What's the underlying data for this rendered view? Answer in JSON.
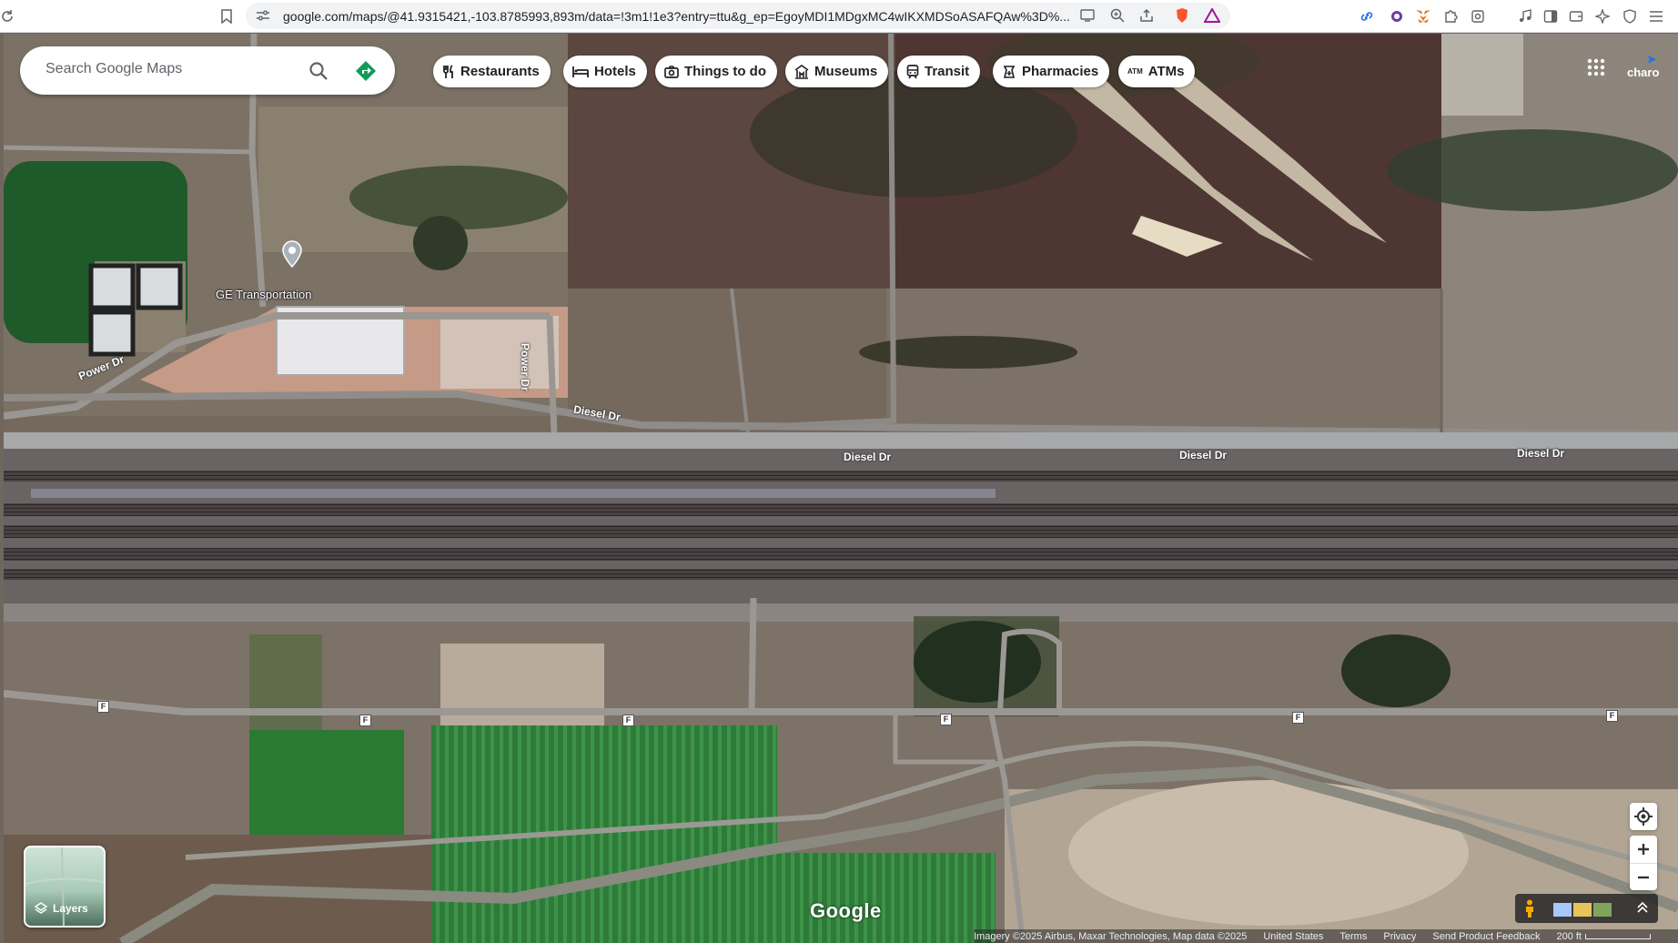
{
  "browser": {
    "url": "google.com/maps/@41.9315421,-103.8785993,893m/data=!3m1!1e3?entry=ttu&g_ep=EgoyMDI1MDgxMC4wIKXMDSoASAFQAw%3D%..."
  },
  "search": {
    "placeholder": "Search Google Maps"
  },
  "chips": [
    {
      "label": "Restaurants",
      "icon": "fork-knife-icon"
    },
    {
      "label": "Hotels",
      "icon": "bed-icon"
    },
    {
      "label": "Things to do",
      "icon": "camera-icon"
    },
    {
      "label": "Museums",
      "icon": "museum-icon"
    },
    {
      "label": "Transit",
      "icon": "train-icon"
    },
    {
      "label": "Pharmacies",
      "icon": "pharmacy-icon"
    },
    {
      "label": "ATMs",
      "icon": "atm-icon"
    }
  ],
  "atm_glyph": "ATM",
  "account_label": "charo",
  "map": {
    "place_name": "GE Transportation",
    "roads": {
      "power_dr_1": "Power Dr",
      "power_dr_2": "Power Dr",
      "diesel_dr_1": "Diesel Dr",
      "diesel_dr_2": "Diesel Dr",
      "diesel_dr_3": "Diesel Dr",
      "diesel_dr_4": "Diesel Dr"
    },
    "route_marker": "F"
  },
  "layers_label": "Layers",
  "logo_text": "Google",
  "attribution": {
    "imagery": "Imagery ©2025 Airbus, Maxar Technologies, Map data ©2025",
    "region": "United States",
    "terms": "Terms",
    "privacy": "Privacy",
    "feedback": "Send Product Feedback",
    "scale": "200 ft"
  },
  "colors": {
    "accent": "#1a73e8",
    "directions": "#0f9d58"
  }
}
